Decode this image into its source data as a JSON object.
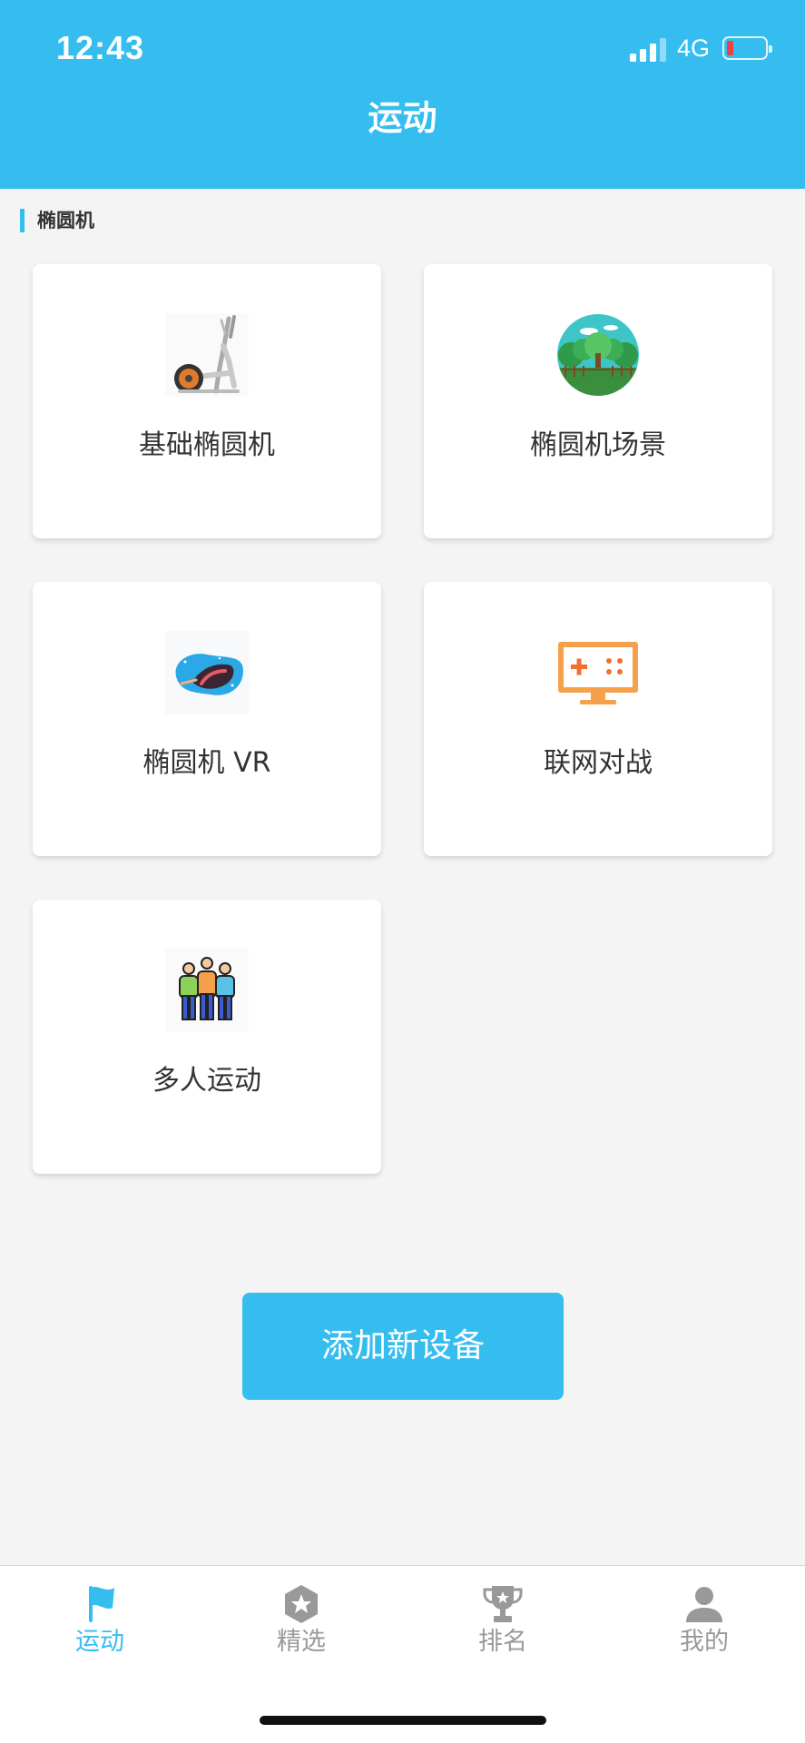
{
  "status": {
    "time": "12:43",
    "network": "4G"
  },
  "header": {
    "title": "运动"
  },
  "section": {
    "title": "椭圆机"
  },
  "cards": [
    {
      "label": "基础椭圆机",
      "icon": "elliptical-machine-icon"
    },
    {
      "label": "椭圆机场景",
      "icon": "forest-scene-icon"
    },
    {
      "label": "椭圆机 VR",
      "icon": "vr-headset-icon"
    },
    {
      "label": "联网对战",
      "icon": "game-screen-icon"
    },
    {
      "label": "多人运动",
      "icon": "group-people-icon"
    }
  ],
  "add_button": {
    "label": "添加新设备"
  },
  "tabs": [
    {
      "label": "运动",
      "icon": "flag-icon",
      "active": true
    },
    {
      "label": "精选",
      "icon": "star-badge-icon",
      "active": false
    },
    {
      "label": "排名",
      "icon": "trophy-icon",
      "active": false
    },
    {
      "label": "我的",
      "icon": "user-icon",
      "active": false
    }
  ],
  "colors": {
    "accent": "#35bdf0",
    "background": "#f4f4f4",
    "inactive": "#999999",
    "battery_low": "#f04040"
  }
}
